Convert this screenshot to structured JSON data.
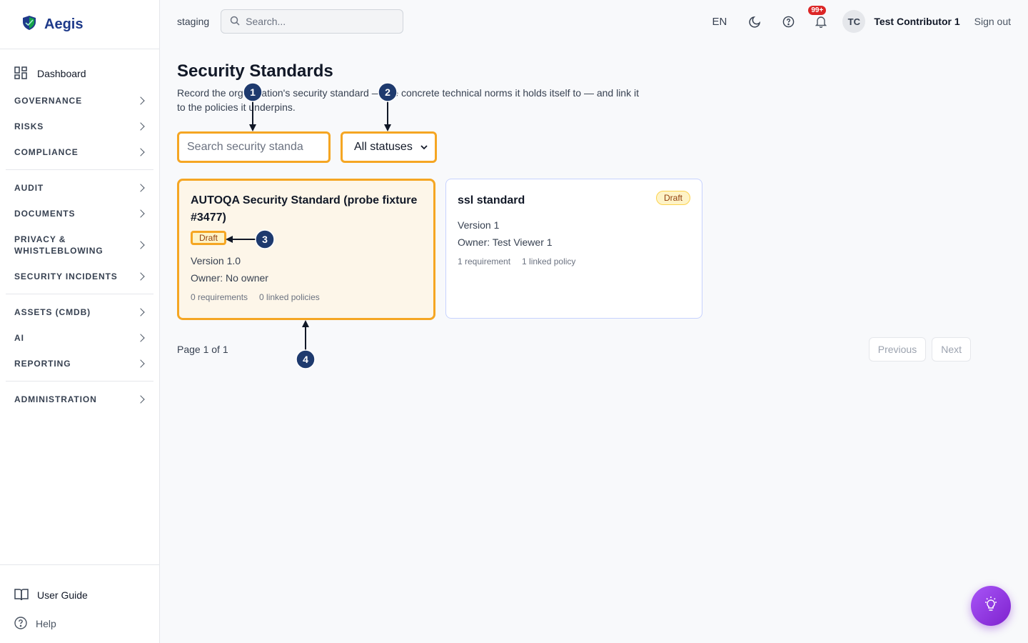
{
  "brand": {
    "name": "Aegis"
  },
  "sidebar": {
    "dashboard": "Dashboard",
    "groups": [
      [
        "GOVERNANCE",
        "RISKS",
        "COMPLIANCE"
      ],
      [
        "AUDIT",
        "DOCUMENTS",
        "PRIVACY & WHISTLEBLOWING",
        "SECURITY INCIDENTS"
      ],
      [
        "ASSETS (CMDB)",
        "AI",
        "REPORTING"
      ],
      [
        "ADMINISTRATION"
      ]
    ],
    "user_guide": "User Guide",
    "help": "Help"
  },
  "topbar": {
    "env": "staging",
    "search_placeholder": "Search...",
    "lang": "EN",
    "notif_count": "99+",
    "avatar_initials": "TC",
    "user_name": "Test Contributor 1",
    "sign_out": "Sign out"
  },
  "page": {
    "title": "Security Standards",
    "description": "Record the organization's security standard — the concrete technical norms it holds itself to — and link it to the policies it underpins.",
    "search_placeholder": "Search security standa",
    "status_filter": "All statuses"
  },
  "cards": [
    {
      "title": "AUTOQA Security Standard (probe fixture #3477)",
      "status": "Draft",
      "version": "Version 1.0",
      "owner": "Owner: No owner",
      "requirements": "0 requirements",
      "policies": "0 linked policies"
    },
    {
      "title": "ssl standard",
      "status": "Draft",
      "version": "Version 1",
      "owner": "Owner: Test Viewer 1",
      "requirements": "1 requirement",
      "policies": "1 linked policy"
    }
  ],
  "pager": {
    "info": "Page 1 of 1",
    "previous": "Previous",
    "next": "Next"
  },
  "annotations": [
    "1",
    "2",
    "3",
    "4"
  ],
  "colors": {
    "accent": "#f5a623",
    "brand": "#1e3a8a",
    "marker": "#1e3a6e",
    "fab": "#9333ea"
  }
}
